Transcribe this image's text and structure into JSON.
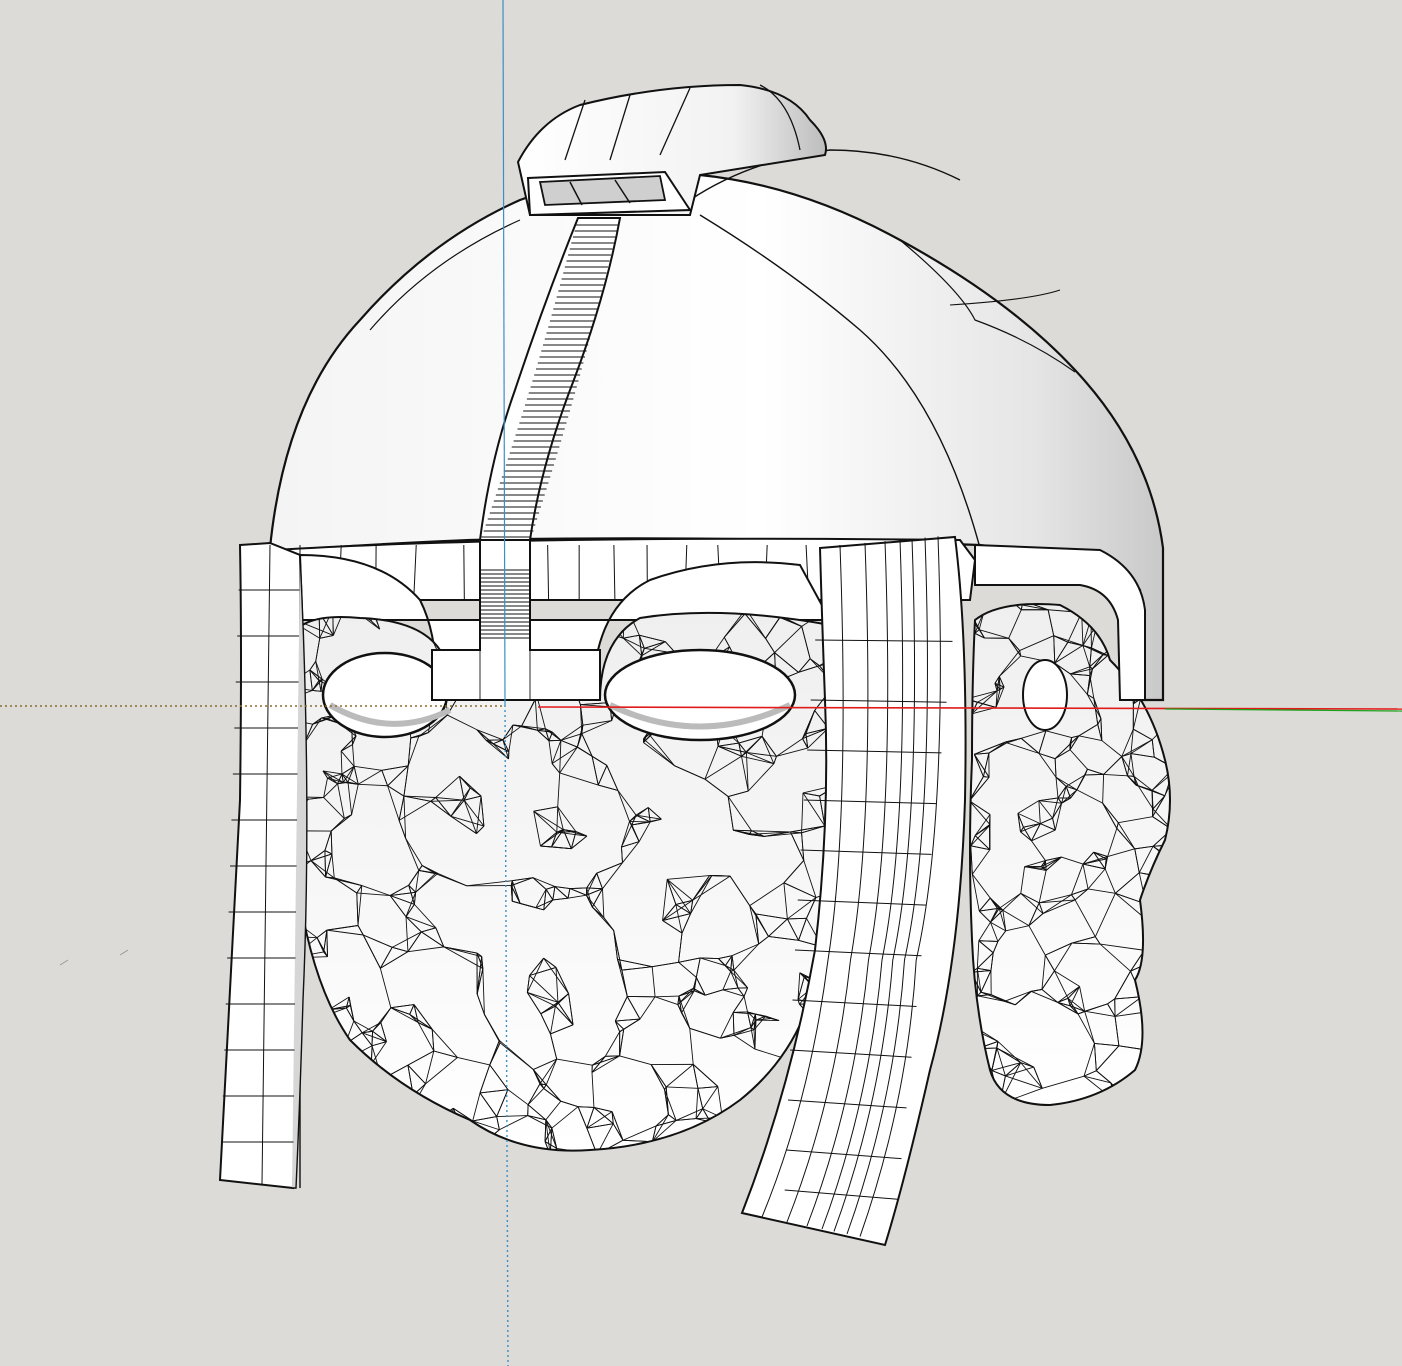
{
  "viewport": {
    "background": "#dcdbd7",
    "model_fill": "#ffffff",
    "model_stroke": "#111111",
    "shade_fill": "#cfcfcf"
  },
  "axes": {
    "red_axis_color": "#e11b1b",
    "green_axis_color": "#1aa31a",
    "blue_axis_color": "#3a8fc6"
  },
  "model": {
    "name": "helmet-with-face-mesh",
    "parts": [
      "helmet-dome",
      "top-crest",
      "nasal-strap",
      "brow-band",
      "left-cheek-guard",
      "right-cheek-guard",
      "face-mesh",
      "side-face-mesh"
    ]
  }
}
